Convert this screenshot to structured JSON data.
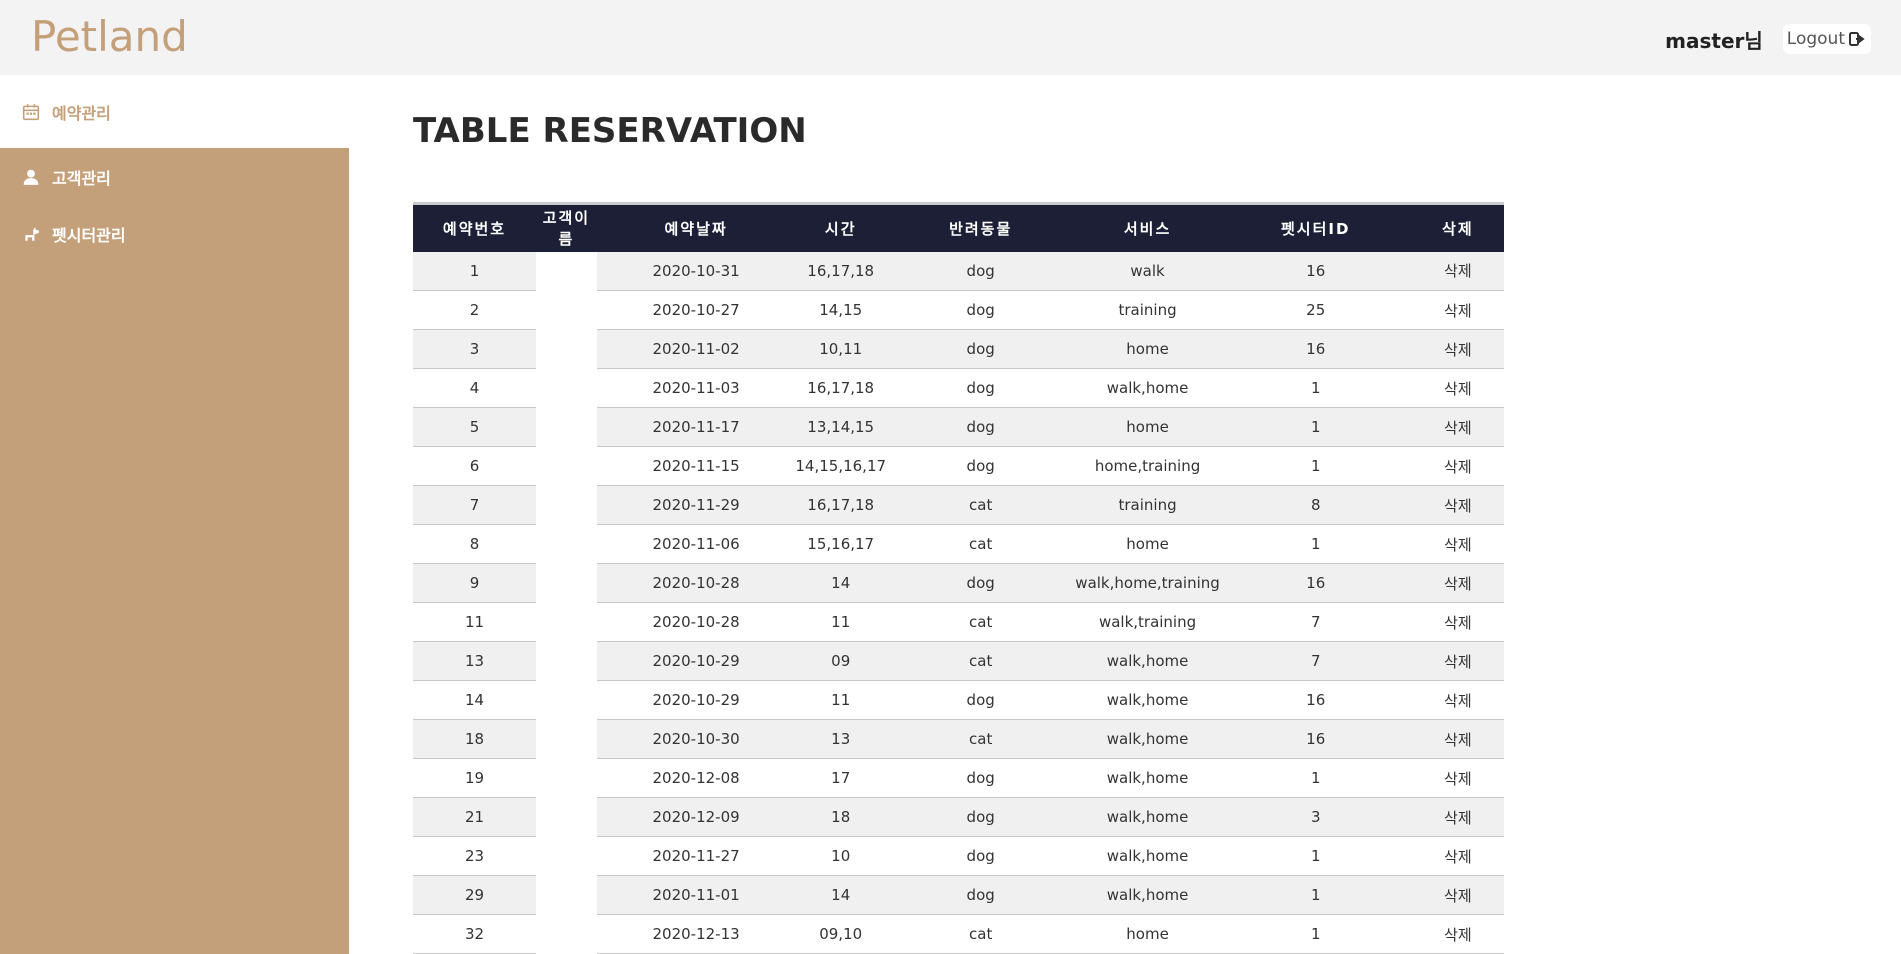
{
  "header": {
    "logo": "Petland",
    "username": "master님",
    "logout_label": "Logout"
  },
  "sidebar": {
    "items": [
      {
        "label": "예약관리",
        "icon": "calendar-icon"
      },
      {
        "label": "고객관리",
        "icon": "user-icon"
      },
      {
        "label": "펫시터관리",
        "icon": "dog-icon"
      }
    ]
  },
  "main": {
    "title": "TABLE RESERVATION",
    "columns": [
      "예약번호",
      "고객이름",
      "예약날짜",
      "시간",
      "반려동물",
      "서비스",
      "펫시터ID",
      "삭제"
    ],
    "rows": [
      [
        "1",
        "",
        "2020-10-31",
        "16,17,18",
        "dog",
        "walk",
        "16",
        "삭제"
      ],
      [
        "2",
        "",
        "2020-10-27",
        "14,15",
        "dog",
        "training",
        "25",
        "삭제"
      ],
      [
        "3",
        "",
        "2020-11-02",
        "10,11",
        "dog",
        "home",
        "16",
        "삭제"
      ],
      [
        "4",
        "",
        "2020-11-03",
        "16,17,18",
        "dog",
        "walk,home",
        "1",
        "삭제"
      ],
      [
        "5",
        "",
        "2020-11-17",
        "13,14,15",
        "dog",
        "home",
        "1",
        "삭제"
      ],
      [
        "6",
        "",
        "2020-11-15",
        "14,15,16,17",
        "dog",
        "home,training",
        "1",
        "삭제"
      ],
      [
        "7",
        "",
        "2020-11-29",
        "16,17,18",
        "cat",
        "training",
        "8",
        "삭제"
      ],
      [
        "8",
        "",
        "2020-11-06",
        "15,16,17",
        "cat",
        "home",
        "1",
        "삭제"
      ],
      [
        "9",
        "",
        "2020-10-28",
        "14",
        "dog",
        "walk,home,training",
        "16",
        "삭제"
      ],
      [
        "11",
        "",
        "2020-10-28",
        "11",
        "cat",
        "walk,training",
        "7",
        "삭제"
      ],
      [
        "13",
        "",
        "2020-10-29",
        "09",
        "cat",
        "walk,home",
        "7",
        "삭제"
      ],
      [
        "14",
        "",
        "2020-10-29",
        "11",
        "dog",
        "walk,home",
        "16",
        "삭제"
      ],
      [
        "18",
        "",
        "2020-10-30",
        "13",
        "cat",
        "walk,home",
        "16",
        "삭제"
      ],
      [
        "19",
        "",
        "2020-12-08",
        "17",
        "dog",
        "walk,home",
        "1",
        "삭제"
      ],
      [
        "21",
        "",
        "2020-12-09",
        "18",
        "dog",
        "walk,home",
        "3",
        "삭제"
      ],
      [
        "23",
        "",
        "2020-11-27",
        "10",
        "dog",
        "walk,home",
        "1",
        "삭제"
      ],
      [
        "29",
        "",
        "2020-11-01",
        "14",
        "dog",
        "walk,home",
        "1",
        "삭제"
      ],
      [
        "32",
        "",
        "2020-12-13",
        "09,10",
        "cat",
        "home",
        "1",
        "삭제"
      ]
    ]
  },
  "colors": {
    "brand": "#c4a07a",
    "header_bg": "#1c1f36",
    "topbar_bg": "#f3f3f3"
  }
}
